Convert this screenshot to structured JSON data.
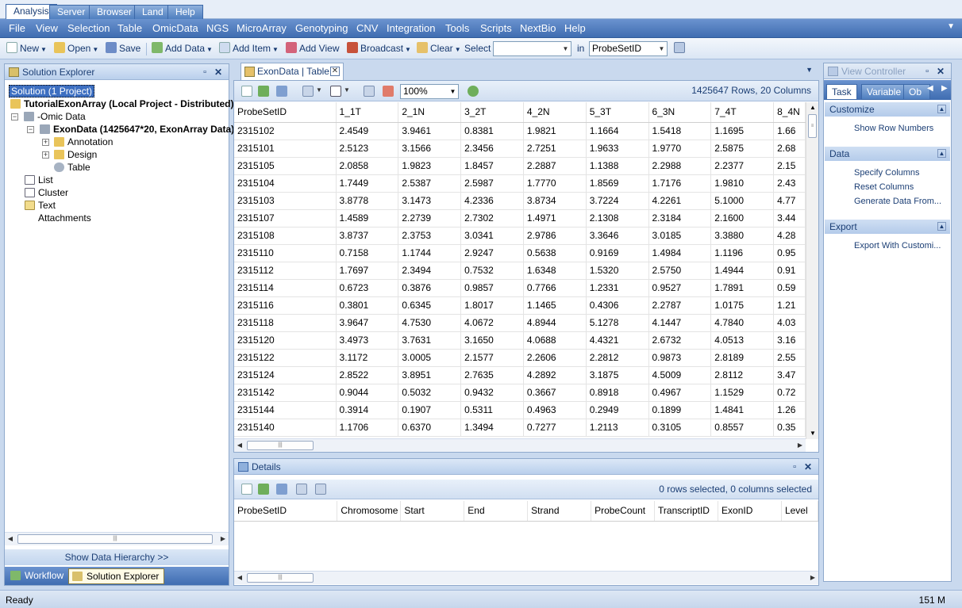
{
  "top_tabs": [
    "Analysis",
    "Server",
    "Browser",
    "Land",
    "Help"
  ],
  "menu": [
    "File",
    "View",
    "Selection",
    "Table",
    "OmicData",
    "NGS",
    "MicroArray",
    "Genotyping",
    "CNV",
    "Integration",
    "Tools",
    "Scripts",
    "NextBio",
    "Help"
  ],
  "toolbar": {
    "new_label": "New",
    "open_label": "Open",
    "save_label": "Save",
    "add_data_label": "Add Data",
    "add_item_label": "Add Item",
    "add_view_label": "Add View",
    "broadcast_label": "Broadcast",
    "clear_label": "Clear",
    "select_label": "Select",
    "select_value": "",
    "in_label": "in",
    "in_value": "ProbeSetID"
  },
  "solution_explorer": {
    "title": "Solution Explorer",
    "tree": {
      "solution": "Solution (1 Project)",
      "project": "TutorialExonArray (Local Project - Distributed)",
      "omic": "-Omic Data",
      "exondata": "ExonData (1425647*20, ExonArray Data)",
      "annotation": "Annotation",
      "design": "Design",
      "table": "Table",
      "list": "List",
      "cluster": "Cluster",
      "text": "Text",
      "attachments": "Attachments"
    },
    "show_hierarchy": "Show Data Hierarchy >>",
    "tabs": [
      "Workflow",
      "Solution Explorer"
    ]
  },
  "document": {
    "tab_title": "ExonData | Table",
    "zoom": "100%",
    "rows_info": "1425647 Rows, 20 Columns",
    "columns": [
      "ProbeSetID",
      "1_1T",
      "2_1N",
      "3_2T",
      "4_2N",
      "5_3T",
      "6_3N",
      "7_4T",
      "8_4N"
    ],
    "rows": [
      [
        "2315102",
        "2.4549",
        "3.9461",
        "0.8381",
        "1.9821",
        "1.1664",
        "1.5418",
        "1.1695",
        "1.66"
      ],
      [
        "2315101",
        "2.5123",
        "3.1566",
        "2.3456",
        "2.7251",
        "1.9633",
        "1.9770",
        "2.5875",
        "2.68"
      ],
      [
        "2315105",
        "2.0858",
        "1.9823",
        "1.8457",
        "2.2887",
        "1.1388",
        "2.2988",
        "2.2377",
        "2.15"
      ],
      [
        "2315104",
        "1.7449",
        "2.5387",
        "2.5987",
        "1.7770",
        "1.8569",
        "1.7176",
        "1.9810",
        "2.43"
      ],
      [
        "2315103",
        "3.8778",
        "3.1473",
        "4.2336",
        "3.8734",
        "3.7224",
        "4.2261",
        "5.1000",
        "4.77"
      ],
      [
        "2315107",
        "1.4589",
        "2.2739",
        "2.7302",
        "1.4971",
        "2.1308",
        "2.3184",
        "2.1600",
        "3.44"
      ],
      [
        "2315108",
        "3.8737",
        "2.3753",
        "3.0341",
        "2.9786",
        "3.3646",
        "3.0185",
        "3.3880",
        "4.28"
      ],
      [
        "2315110",
        "0.7158",
        "1.1744",
        "2.9247",
        "0.5638",
        "0.9169",
        "1.4984",
        "1.1196",
        "0.95"
      ],
      [
        "2315112",
        "1.7697",
        "2.3494",
        "0.7532",
        "1.6348",
        "1.5320",
        "2.5750",
        "1.4944",
        "0.91"
      ],
      [
        "2315114",
        "0.6723",
        "0.3876",
        "0.9857",
        "0.7766",
        "1.2331",
        "0.9527",
        "1.7891",
        "0.59"
      ],
      [
        "2315116",
        "0.3801",
        "0.6345",
        "1.8017",
        "1.1465",
        "0.4306",
        "2.2787",
        "1.0175",
        "1.21"
      ],
      [
        "2315118",
        "3.9647",
        "4.7530",
        "4.0672",
        "4.8944",
        "5.1278",
        "4.1447",
        "4.7840",
        "4.03"
      ],
      [
        "2315120",
        "3.4973",
        "3.7631",
        "3.1650",
        "4.0688",
        "4.4321",
        "2.6732",
        "4.0513",
        "3.16"
      ],
      [
        "2315122",
        "3.1172",
        "3.0005",
        "2.1577",
        "2.2606",
        "2.2812",
        "0.9873",
        "2.8189",
        "2.55"
      ],
      [
        "2315124",
        "2.8522",
        "3.8951",
        "2.7635",
        "4.2892",
        "3.1875",
        "4.5009",
        "2.8112",
        "3.47"
      ],
      [
        "2315142",
        "0.9044",
        "0.5032",
        "0.9432",
        "0.3667",
        "0.8918",
        "0.4967",
        "1.1529",
        "0.72"
      ],
      [
        "2315144",
        "0.3914",
        "0.1907",
        "0.5311",
        "0.4963",
        "0.2949",
        "0.1899",
        "1.4841",
        "1.26"
      ],
      [
        "2315140",
        "1.1706",
        "0.6370",
        "1.3494",
        "0.7277",
        "1.2113",
        "0.3105",
        "0.8557",
        "0.35"
      ]
    ]
  },
  "details": {
    "title": "Details",
    "selection_info": "0 rows selected, 0 columns selected",
    "columns": [
      "ProbeSetID",
      "Chromosome",
      "Start",
      "End",
      "Strand",
      "ProbeCount",
      "TranscriptID",
      "ExonID",
      "Level"
    ]
  },
  "view_controller": {
    "title": "View Controller",
    "tabs": [
      "Task",
      "Variable",
      "Ob"
    ],
    "sections": {
      "customize": "Customize",
      "data": "Data",
      "export": "Export"
    },
    "links": {
      "show_row_numbers": "Show Row Numbers",
      "specify_columns": "Specify Columns",
      "reset_columns": "Reset Columns",
      "generate_data": "Generate Data From...",
      "export_custom": "Export With Customi..."
    }
  },
  "status": {
    "text": "Ready",
    "memory": "151 M"
  },
  "colors": {
    "menubar": "#3f6db1",
    "panel_bg": "#c9d9ee",
    "selection": "#3d6fc1"
  }
}
